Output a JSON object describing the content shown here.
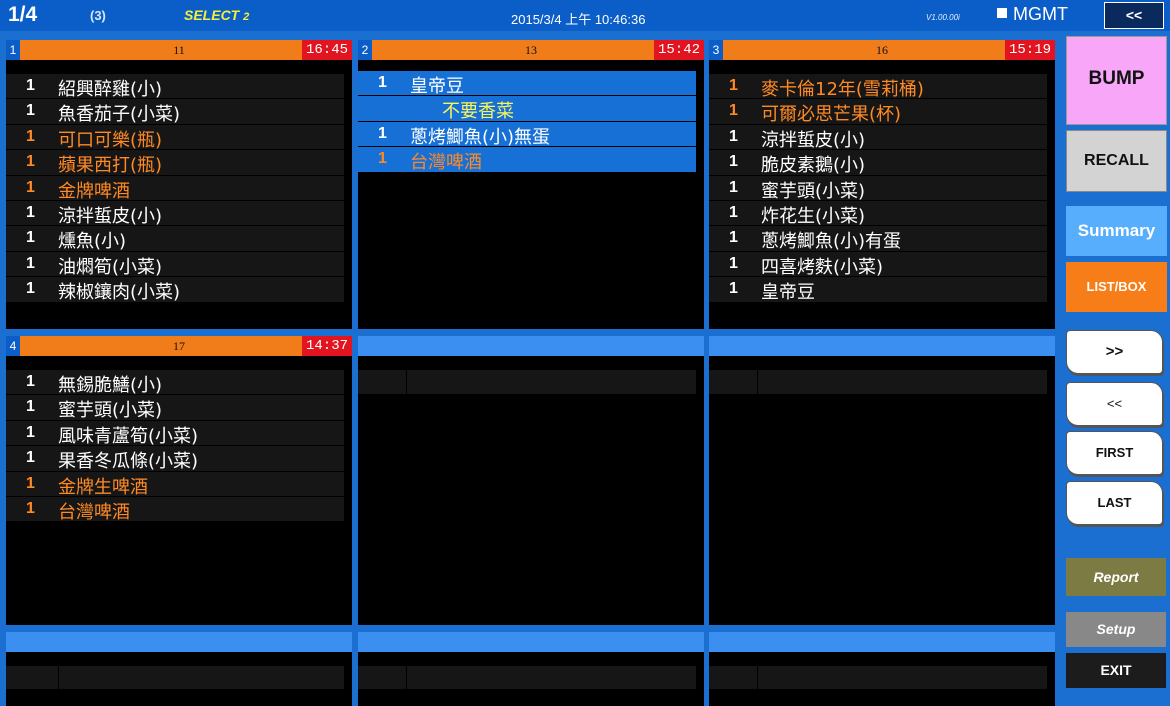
{
  "topbar": {
    "page": "1/4",
    "count": "(3)",
    "select_label": "SELECT",
    "select_num": "2",
    "datetime": "2015/3/4 上午 10:46:36",
    "version": "V1.00.00i",
    "mgmt": "MGMT",
    "back": "<<"
  },
  "orders": [
    {
      "num": "1",
      "table": "11",
      "time": "16:45",
      "items": [
        {
          "qty": "1",
          "name": "紹興醉雞(小)"
        },
        {
          "qty": "1",
          "name": "魚香茄子(小菜)"
        },
        {
          "qty": "1",
          "name": "可口可樂(瓶)"
        },
        {
          "qty": "1",
          "name": "蘋果西打(瓶)"
        },
        {
          "qty": "1",
          "name": "金牌啤酒"
        },
        {
          "qty": "1",
          "name": "涼拌蜇皮(小)"
        },
        {
          "qty": "1",
          "name": "燻魚(小)"
        },
        {
          "qty": "1",
          "name": "油燜筍(小菜)"
        },
        {
          "qty": "1",
          "name": "辣椒鑲肉(小菜)"
        }
      ]
    },
    {
      "num": "2",
      "table": "13",
      "time": "15:42",
      "items": [
        {
          "qty": "1",
          "name": "皇帝豆"
        },
        {
          "qty": "",
          "name": "不要香菜"
        },
        {
          "qty": "1",
          "name": "蔥烤鯽魚(小)無蛋"
        },
        {
          "qty": "1",
          "name": "台灣啤酒"
        }
      ]
    },
    {
      "num": "3",
      "table": "16",
      "time": "15:19",
      "items": [
        {
          "qty": "1",
          "name": "麥卡倫12年(雪莉桶)"
        },
        {
          "qty": "1",
          "name": "可爾必思芒果(杯)"
        },
        {
          "qty": "1",
          "name": "涼拌蜇皮(小)"
        },
        {
          "qty": "1",
          "name": "脆皮素鵝(小)"
        },
        {
          "qty": "1",
          "name": "蜜芋頭(小菜)"
        },
        {
          "qty": "1",
          "name": "炸花生(小菜)"
        },
        {
          "qty": "1",
          "name": "蔥烤鯽魚(小)有蛋"
        },
        {
          "qty": "1",
          "name": "四喜烤麩(小菜)"
        },
        {
          "qty": "1",
          "name": "皇帝豆"
        }
      ]
    },
    {
      "num": "4",
      "table": "17",
      "time": "14:37",
      "items": [
        {
          "qty": "1",
          "name": "無錫脆鱔(小)"
        },
        {
          "qty": "1",
          "name": "蜜芋頭(小菜)"
        },
        {
          "qty": "1",
          "name": "風味青蘆筍(小菜)"
        },
        {
          "qty": "1",
          "name": "果香冬瓜條(小菜)"
        },
        {
          "qty": "1",
          "name": "金牌生啤酒"
        },
        {
          "qty": "1",
          "name": "台灣啤酒"
        }
      ]
    }
  ],
  "sidebar": {
    "bump": "BUMP",
    "recall": "RECALL",
    "summary": "Summary",
    "listbox": "LIST/BOX",
    "next": ">>",
    "prev": "<<",
    "first": "FIRST",
    "last": "LAST",
    "report": "Report",
    "setup": "Setup",
    "exit": "EXIT"
  },
  "colors": {
    "background": "#1a6fd0",
    "header_orange": "#f07d1a",
    "time_red": "#e2141f",
    "item_orange": "#ff8a24",
    "modifier_yellow": "#fbf55a",
    "bump_pink": "#f8a6f8",
    "summary_blue": "#56aefc"
  }
}
